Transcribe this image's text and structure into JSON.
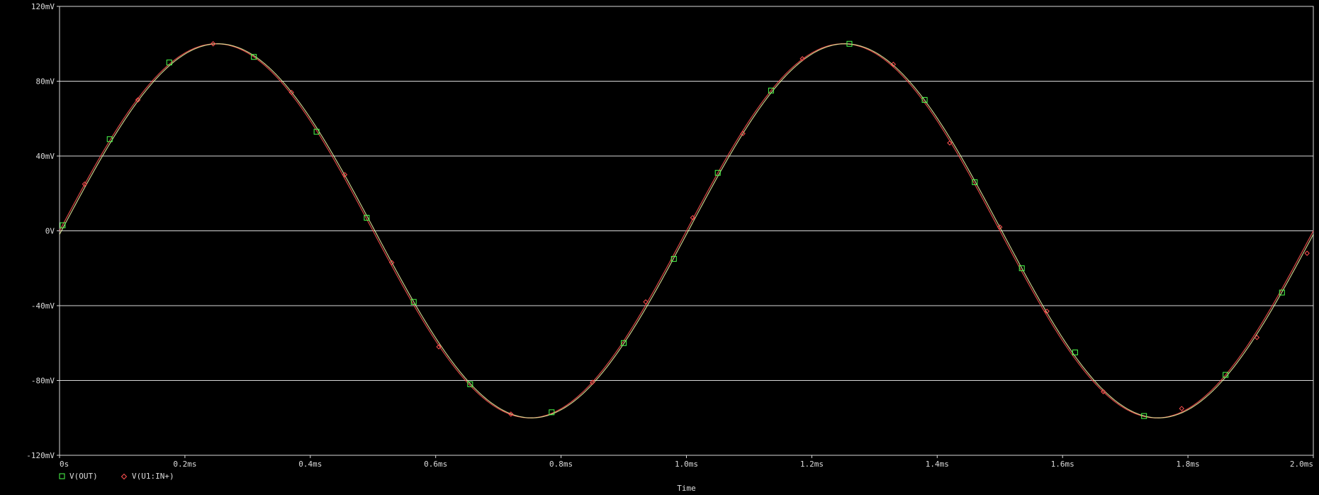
{
  "chart_data": {
    "type": "line",
    "title": "",
    "xlabel": "Time",
    "ylabel": "",
    "xlim": [
      0,
      2.0
    ],
    "ylim": [
      -120,
      120
    ],
    "grid": true,
    "x_ticks": [
      0,
      0.2,
      0.4,
      0.6,
      0.8,
      1.0,
      1.2,
      1.4,
      1.6,
      1.8,
      2.0
    ],
    "x_tick_labels": [
      "0s",
      "0.2ms",
      "0.4ms",
      "0.6ms",
      "0.8ms",
      "1.0ms",
      "1.2ms",
      "1.4ms",
      "1.6ms",
      "1.8ms",
      "2.0ms"
    ],
    "y_ticks": [
      120,
      80,
      40,
      0,
      -40,
      -80,
      -120
    ],
    "y_tick_labels": [
      "120mV",
      "80mV",
      "40mV",
      "0V",
      "-40mV",
      "-80mV",
      "-120mV"
    ],
    "legend_position": "bottom-left",
    "series": [
      {
        "name": "V(OUT)",
        "color": "#4cff4c",
        "marker": "square",
        "x": [
          0.005,
          0.08,
          0.175,
          0.31,
          0.41,
          0.49,
          0.565,
          0.655,
          0.785,
          0.9,
          0.98,
          1.05,
          1.135,
          1.26,
          1.38,
          1.46,
          1.535,
          1.62,
          1.73,
          1.86,
          1.95
        ],
        "y": [
          3,
          49,
          90,
          93,
          53,
          7,
          -38,
          -82,
          -97,
          -60,
          -15,
          31,
          75,
          100,
          70,
          26,
          -20,
          -65,
          -99,
          -77,
          -33
        ]
      },
      {
        "name": "V(U1:IN+)",
        "color": "#ff5050",
        "marker": "diamond",
        "x": [
          0.04,
          0.125,
          0.245,
          0.37,
          0.455,
          0.53,
          0.605,
          0.72,
          0.85,
          0.935,
          1.01,
          1.09,
          1.185,
          1.33,
          1.42,
          1.5,
          1.575,
          1.665,
          1.79,
          1.91,
          1.99
        ],
        "y": [
          25,
          70,
          100,
          74,
          30,
          -17,
          -62,
          -98,
          -81,
          -38,
          7,
          52,
          92,
          89,
          47,
          2,
          -43,
          -86,
          -95,
          -57,
          -12
        ]
      }
    ]
  }
}
